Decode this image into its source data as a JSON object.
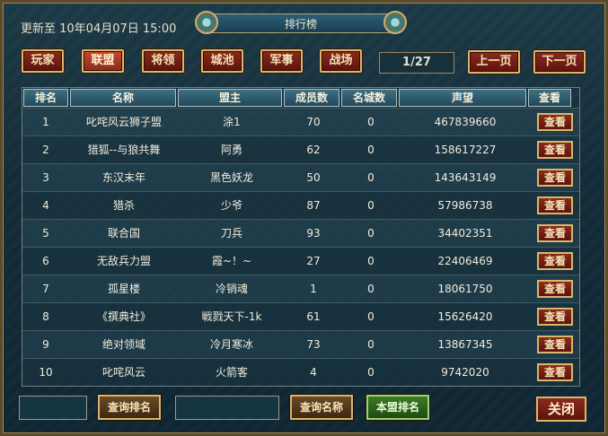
{
  "header": {
    "updated_text": "更新至 10年04月07日 15:00",
    "title": "排行榜"
  },
  "tabs": [
    {
      "label": "玩家",
      "active": false
    },
    {
      "label": "联盟",
      "active": true
    },
    {
      "label": "将领",
      "active": false
    },
    {
      "label": "城池",
      "active": false
    },
    {
      "label": "军事",
      "active": false
    },
    {
      "label": "战场",
      "active": false
    }
  ],
  "pagination": {
    "indicator": "1/27",
    "prev_label": "上一页",
    "next_label": "下一页"
  },
  "table": {
    "columns": [
      "排名",
      "名称",
      "盟主",
      "成员数",
      "名城数",
      "声望",
      "查看"
    ],
    "rows": [
      {
        "rank": "1",
        "name": "叱咤风云狮子盟",
        "leader": "涂1",
        "members": "70",
        "cities": "0",
        "prestige": "467839660",
        "view": "查看"
      },
      {
        "rank": "2",
        "name": "猎狐--与狼共舞",
        "leader": "阿勇",
        "members": "62",
        "cities": "0",
        "prestige": "158617227",
        "view": "查看"
      },
      {
        "rank": "3",
        "name": "东汉末年",
        "leader": "黑色妖龙",
        "members": "50",
        "cities": "0",
        "prestige": "143643149",
        "view": "查看"
      },
      {
        "rank": "4",
        "name": "猎杀",
        "leader": "少爷",
        "members": "87",
        "cities": "0",
        "prestige": "57986738",
        "view": "查看"
      },
      {
        "rank": "5",
        "name": "联合国",
        "leader": "刀兵",
        "members": "93",
        "cities": "0",
        "prestige": "34402351",
        "view": "查看"
      },
      {
        "rank": "6",
        "name": "无敌兵力盟",
        "leader": "霞~！~",
        "members": "27",
        "cities": "0",
        "prestige": "22406469",
        "view": "查看"
      },
      {
        "rank": "7",
        "name": "孤星楼",
        "leader": "冷销魂",
        "members": "1",
        "cities": "0",
        "prestige": "18061750",
        "view": "查看"
      },
      {
        "rank": "8",
        "name": "《撰典社》",
        "leader": "戦戮天下-1k",
        "members": "61",
        "cities": "0",
        "prestige": "15626420",
        "view": "查看"
      },
      {
        "rank": "9",
        "name": "绝对领域",
        "leader": "冷月寒冰",
        "members": "73",
        "cities": "0",
        "prestige": "13867345",
        "view": "查看"
      },
      {
        "rank": "10",
        "name": "叱咤风云",
        "leader": "火箭客",
        "members": "4",
        "cities": "0",
        "prestige": "9742020",
        "view": "查看"
      }
    ]
  },
  "footer": {
    "query_rank_label": "查询排名",
    "query_name_label": "查询名称",
    "my_alliance_rank_label": "本盟排名",
    "close_label": "关闭",
    "rank_input_value": "",
    "name_input_value": ""
  }
}
